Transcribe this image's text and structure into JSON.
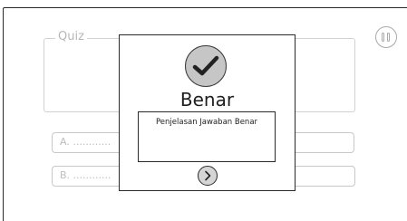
{
  "quiz": {
    "legend": "Quiz",
    "options": [
      {
        "letter": "A.",
        "text": "............"
      },
      {
        "letter": "B.",
        "text": "............"
      }
    ]
  },
  "controls": {
    "pause_icon": "pause-icon"
  },
  "result_modal": {
    "icon": "checkmark-icon",
    "title": "Benar",
    "explanation": "Penjelasan Jawaban Benar",
    "next_icon": "chevron-right-icon"
  }
}
